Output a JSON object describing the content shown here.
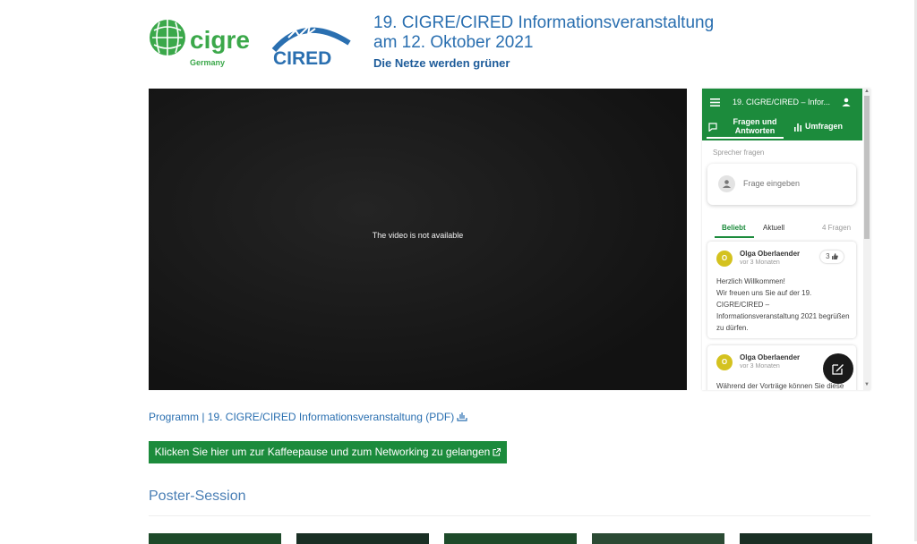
{
  "header": {
    "cigre_logo_text": "cigre",
    "cigre_logo_sub": "Germany",
    "cired_logo_text": "CIRED",
    "title_line1": "19. CIGRE/CIRED Informationsveranstaltung",
    "title_line2": "am 12. Oktober 2021",
    "subtitle": "Die Netze werden grüner"
  },
  "video": {
    "message": "The video is not available"
  },
  "qa_widget": {
    "title": "19. CIGRE/CIRED – Infor...",
    "tab_qa_label": "Fragen und Antworten",
    "tab_polls_label": "Umfragen",
    "ask_label": "Sprecher fragen",
    "ask_placeholder": "Frage eingeben",
    "sort_popular": "Beliebt",
    "sort_recent": "Aktuell",
    "question_count": "4 Fragen",
    "questions": [
      {
        "avatar_initial": "O",
        "author": "Olga Oberlaender",
        "time": "vor 3 Monaten",
        "likes": "3",
        "text": "Herzlich Willkommen!\nWir freuen uns Sie auf der 19. CIGRE/CIRED – Informationsveranstaltung 2021 begrüßen zu dürfen."
      },
      {
        "avatar_initial": "O",
        "author": "Olga Oberlaender",
        "time": "vor 3 Monaten",
        "text": "Während der Vorträge können Sie diese"
      }
    ]
  },
  "program_link": "Programm | 19. CIGRE/CIRED Informationsveranstaltung (PDF)",
  "networking_button": "Klicken Sie hier um zur Kaffeepause und zum Networking zu gelangen",
  "poster_session_title": "Poster-Session",
  "colors": {
    "green": "#1c8b3c",
    "blue": "#2a6fb0",
    "avatar_yellow": "#d4c21f"
  },
  "icons": [
    "menu-icon",
    "user-icon",
    "chat-icon",
    "bar-chart-icon",
    "thumbs-up-icon",
    "compose-icon",
    "download-icon",
    "external-link-icon"
  ]
}
